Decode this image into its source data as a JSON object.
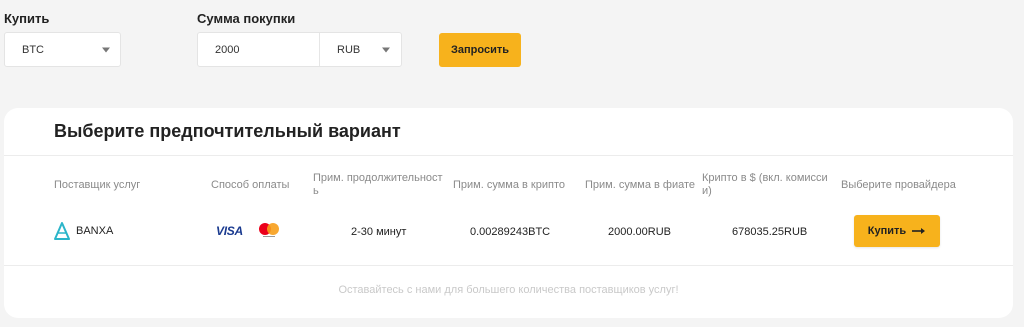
{
  "form": {
    "buy_label": "Купить",
    "buy_currency": "BTC",
    "amount_label": "Сумма покупки",
    "amount_value": "2000",
    "fiat_currency": "RUB",
    "request_button": "Запросить"
  },
  "offers": {
    "title": "Выберите предпочтительный вариант",
    "columns": [
      "Поставщик услуг",
      "Способ оплаты",
      "Прим. продолжительност",
      "ь",
      "Прим. сумма в крипто",
      "Прим. сумма в фиате",
      "Крипто в $ (вкл. комисси",
      "и)",
      "Выберите провайдера"
    ],
    "rows": [
      {
        "provider": "BANXA",
        "payment_visa": "VISA",
        "duration": "2-30 минут",
        "crypto_amount": "0.00289243BTC",
        "fiat_amount": "2000.00RUB",
        "crypto_usd": "678035.25RUB",
        "buy_button": "Купить"
      }
    ],
    "footer": "Оставайтесь с нами для большего количества поставщиков услуг!"
  },
  "colors": {
    "accent": "#f7b21c",
    "background": "#f4f4f4",
    "muted_text": "#8a8a8a"
  },
  "icons": [
    "banxa-logo-icon",
    "visa-icon",
    "mastercard-icon",
    "arrow-right-icon",
    "dropdown-caret-icon"
  ]
}
